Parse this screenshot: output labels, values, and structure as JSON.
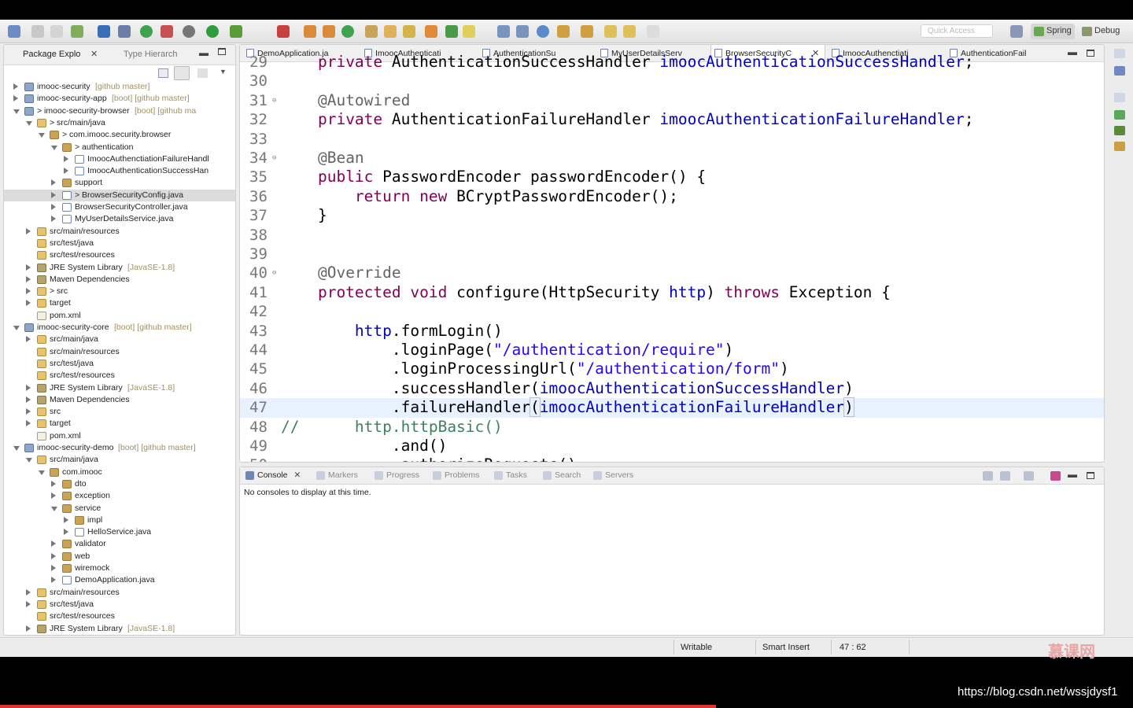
{
  "toolbar": {
    "quick_access_placeholder": "Quick Access"
  },
  "perspectives": [
    {
      "label": "Spring"
    },
    {
      "label": "Debug"
    }
  ],
  "explorer": {
    "tabs": [
      {
        "label": "Package Explo"
      },
      {
        "label": "Type Hierarch"
      }
    ],
    "rows": [
      {
        "name": "imooc-security",
        "extra": "[github master]",
        "depth": 0,
        "state": "closed",
        "icon": "proj"
      },
      {
        "name": "imooc-security-app",
        "extra": "[boot] [github master]",
        "depth": 0,
        "state": "closed",
        "icon": "proj"
      },
      {
        "name": "> imooc-security-browser",
        "extra": "[boot] [github ma",
        "depth": 0,
        "state": "open",
        "icon": "proj"
      },
      {
        "name": "> src/main/java",
        "extra": "",
        "depth": 1,
        "state": "open",
        "icon": "fold"
      },
      {
        "name": "> com.imooc.security.browser",
        "extra": "",
        "depth": 2,
        "state": "open",
        "icon": "pkg"
      },
      {
        "name": "> authentication",
        "extra": "",
        "depth": 3,
        "state": "open",
        "icon": "pkg"
      },
      {
        "name": "ImoocAuthenctiationFailureHandl",
        "extra": "",
        "depth": 4,
        "state": "closed",
        "icon": "java"
      },
      {
        "name": "ImoocAuthenticationSuccessHan",
        "extra": "",
        "depth": 4,
        "state": "closed",
        "icon": "java"
      },
      {
        "name": "support",
        "extra": "",
        "depth": 3,
        "state": "closed",
        "icon": "pkg"
      },
      {
        "name": "> BrowserSecurityConfig.java",
        "extra": "",
        "depth": 3,
        "state": "closed",
        "icon": "java",
        "selected": true
      },
      {
        "name": "BrowserSecurityController.java",
        "extra": "",
        "depth": 3,
        "state": "closed",
        "icon": "java"
      },
      {
        "name": "MyUserDetailsService.java",
        "extra": "",
        "depth": 3,
        "state": "closed",
        "icon": "java"
      },
      {
        "name": "src/main/resources",
        "extra": "",
        "depth": 1,
        "state": "closed",
        "icon": "fold"
      },
      {
        "name": "src/test/java",
        "extra": "",
        "depth": 1,
        "state": "none",
        "icon": "fold"
      },
      {
        "name": "src/test/resources",
        "extra": "",
        "depth": 1,
        "state": "none",
        "icon": "fold"
      },
      {
        "name": "JRE System Library",
        "extra": "[JavaSE-1.8]",
        "depth": 1,
        "state": "closed",
        "icon": "lib"
      },
      {
        "name": "Maven Dependencies",
        "extra": "",
        "depth": 1,
        "state": "closed",
        "icon": "lib"
      },
      {
        "name": "> src",
        "extra": "",
        "depth": 1,
        "state": "closed",
        "icon": "fold"
      },
      {
        "name": "target",
        "extra": "",
        "depth": 1,
        "state": "closed",
        "icon": "fold"
      },
      {
        "name": "pom.xml",
        "extra": "",
        "depth": 1,
        "state": "none",
        "icon": "xml"
      },
      {
        "name": "imooc-security-core",
        "extra": "[boot] [github master]",
        "depth": 0,
        "state": "open",
        "icon": "proj"
      },
      {
        "name": "src/main/java",
        "extra": "",
        "depth": 1,
        "state": "closed",
        "icon": "fold"
      },
      {
        "name": "src/main/resources",
        "extra": "",
        "depth": 1,
        "state": "none",
        "icon": "fold"
      },
      {
        "name": "src/test/java",
        "extra": "",
        "depth": 1,
        "state": "none",
        "icon": "fold"
      },
      {
        "name": "src/test/resources",
        "extra": "",
        "depth": 1,
        "state": "none",
        "icon": "fold"
      },
      {
        "name": "JRE System Library",
        "extra": "[JavaSE-1.8]",
        "depth": 1,
        "state": "closed",
        "icon": "lib"
      },
      {
        "name": "Maven Dependencies",
        "extra": "",
        "depth": 1,
        "state": "closed",
        "icon": "lib"
      },
      {
        "name": "src",
        "extra": "",
        "depth": 1,
        "state": "closed",
        "icon": "fold"
      },
      {
        "name": "target",
        "extra": "",
        "depth": 1,
        "state": "closed",
        "icon": "fold"
      },
      {
        "name": "pom.xml",
        "extra": "",
        "depth": 1,
        "state": "none",
        "icon": "xml"
      },
      {
        "name": "imooc-security-demo",
        "extra": "[boot] [github master]",
        "depth": 0,
        "state": "open",
        "icon": "proj"
      },
      {
        "name": "src/main/java",
        "extra": "",
        "depth": 1,
        "state": "open",
        "icon": "fold"
      },
      {
        "name": "com.imooc",
        "extra": "",
        "depth": 2,
        "state": "open",
        "icon": "pkg"
      },
      {
        "name": "dto",
        "extra": "",
        "depth": 3,
        "state": "closed",
        "icon": "pkg"
      },
      {
        "name": "exception",
        "extra": "",
        "depth": 3,
        "state": "closed",
        "icon": "pkg"
      },
      {
        "name": "service",
        "extra": "",
        "depth": 3,
        "state": "open",
        "icon": "pkg"
      },
      {
        "name": "impl",
        "extra": "",
        "depth": 4,
        "state": "closed",
        "icon": "pkg"
      },
      {
        "name": "HelloService.java",
        "extra": "",
        "depth": 4,
        "state": "closed",
        "icon": "java"
      },
      {
        "name": "validator",
        "extra": "",
        "depth": 3,
        "state": "closed",
        "icon": "pkg"
      },
      {
        "name": "web",
        "extra": "",
        "depth": 3,
        "state": "closed",
        "icon": "pkg"
      },
      {
        "name": "wiremock",
        "extra": "",
        "depth": 3,
        "state": "closed",
        "icon": "pkg"
      },
      {
        "name": "DemoApplication.java",
        "extra": "",
        "depth": 3,
        "state": "closed",
        "icon": "java"
      },
      {
        "name": "src/main/resources",
        "extra": "",
        "depth": 1,
        "state": "closed",
        "icon": "fold"
      },
      {
        "name": "src/test/java",
        "extra": "",
        "depth": 1,
        "state": "closed",
        "icon": "fold"
      },
      {
        "name": "src/test/resources",
        "extra": "",
        "depth": 1,
        "state": "none",
        "icon": "fold"
      },
      {
        "name": "JRE System Library",
        "extra": "[JavaSE-1.8]",
        "depth": 1,
        "state": "closed",
        "icon": "lib"
      }
    ]
  },
  "editor": {
    "tabs": [
      {
        "label": "DemoApplication.ja"
      },
      {
        "label": "ImoocAuthenticati"
      },
      {
        "label": "AuthenticationSu"
      },
      {
        "label": "MyUserDetailsServ"
      },
      {
        "label": "BrowserSecurityC",
        "active": true
      },
      {
        "label": "ImoocAuthenctiati"
      },
      {
        "label": "AuthenticationFail"
      }
    ],
    "lines": [
      {
        "n": "29",
        "html": "    <span class='kw'>private</span> AuthenticationSuccessHandler <span class='fd'>imoocAuthenticationSuccessHandler</span>;"
      },
      {
        "n": "30",
        "html": ""
      },
      {
        "n": "31",
        "fold": true,
        "html": "    <span class='an'>@Autowired</span>"
      },
      {
        "n": "32",
        "html": "    <span class='kw'>private</span> AuthenticationFailureHandler <span class='fd'>imoocAuthenticationFailureHandler</span>;"
      },
      {
        "n": "33",
        "html": ""
      },
      {
        "n": "34",
        "fold": true,
        "html": "    <span class='an'>@Bean</span>"
      },
      {
        "n": "35",
        "html": "    <span class='kw'>public</span> PasswordEncoder passwordEncoder() {"
      },
      {
        "n": "36",
        "html": "        <span class='kw'>return new</span> BCryptPasswordEncoder();"
      },
      {
        "n": "37",
        "html": "    }"
      },
      {
        "n": "38",
        "html": ""
      },
      {
        "n": "39",
        "html": ""
      },
      {
        "n": "40",
        "fold": true,
        "html": "    <span class='an'>@Override</span>"
      },
      {
        "n": "41",
        "html": "    <span class='kw'>protected void</span> configure(HttpSecurity <span class='fd'>http</span>) <span class='kw'>throws</span> Exception {"
      },
      {
        "n": "42",
        "html": ""
      },
      {
        "n": "43",
        "html": "        <span class='fd'>http</span>.formLogin()"
      },
      {
        "n": "44",
        "html": "            .loginPage(<span class='st'>\"/authentication/require\"</span>)"
      },
      {
        "n": "45",
        "html": "            .loginProcessingUrl(<span class='st'>\"/authentication/form\"</span>)"
      },
      {
        "n": "46",
        "html": "            .successHandler(<span class='fd'>imoocAuthenticationSuccessHandler</span>)"
      },
      {
        "n": "47",
        "current": true,
        "html": "            .failureHandler<span class='hlbox'>(</span><span class='fd'>imoocAuthenticationFailureHandler</span><span class='hlbox'>)</span>"
      },
      {
        "n": "48",
        "html": "<span class='cm'>//      http.httpBasic()</span>"
      },
      {
        "n": "49",
        "html": "            .and()"
      },
      {
        "n": "50",
        "html": "            .authorizeRequests()"
      }
    ]
  },
  "console": {
    "tabs": [
      {
        "label": "Console",
        "active": true
      },
      {
        "label": "Markers"
      },
      {
        "label": "Progress"
      },
      {
        "label": "Problems"
      },
      {
        "label": "Tasks"
      },
      {
        "label": "Search"
      },
      {
        "label": "Servers"
      }
    ],
    "message": "No consoles to display at this time."
  },
  "status": {
    "writable": "Writable",
    "insert_mode": "Smart Insert",
    "position": "47 : 62"
  },
  "watermark": {
    "logo": "慕课网",
    "url": "https://blog.csdn.net/wssjdysf1"
  },
  "colors": {
    "keyword": "#7f0055",
    "field": "#0000c0",
    "string": "#2a00ff",
    "comment": "#3f7f5f",
    "annotation": "#646464"
  }
}
